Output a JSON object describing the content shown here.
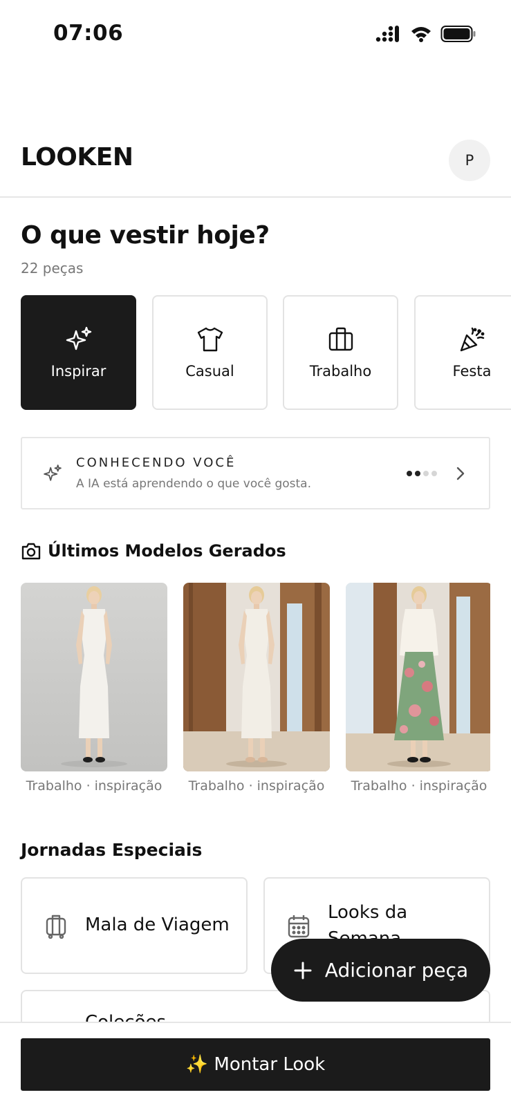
{
  "status_bar": {
    "time": "07:06",
    "icons": [
      "cellular-signal-icon",
      "wifi-icon",
      "battery-icon"
    ]
  },
  "header": {
    "title": "LOOKEN",
    "avatar_initial": "P"
  },
  "greeting": {
    "title": "O que vestir hoje?",
    "pieces": "22 peças"
  },
  "categories": [
    {
      "label": "Inspirar",
      "icon": "sparkles-icon",
      "active": true
    },
    {
      "label": "Casual",
      "icon": "tshirt-icon",
      "active": false
    },
    {
      "label": "Trabalho",
      "icon": "briefcase-icon",
      "active": false
    },
    {
      "label": "Festa",
      "icon": "party-popper-icon",
      "active": false
    }
  ],
  "learning": {
    "title": "CONHECENDO VOCÊ",
    "subtitle": "A IA está aprendendo o que você gosta.",
    "progress_steps_done": 2,
    "progress_steps_total": 4
  },
  "models_section": {
    "title": "Últimos Modelos Gerados",
    "items": [
      {
        "caption": "Trabalho · inspiração"
      },
      {
        "caption": "Trabalho · inspiração"
      },
      {
        "caption": "Trabalho · inspiração"
      }
    ]
  },
  "journeys": {
    "title": "Jornadas Especiais",
    "items": [
      {
        "label": "Mala de Viagem",
        "icon": "luggage-icon"
      },
      {
        "label": "Looks da Semana",
        "icon": "calendar-icon"
      },
      {
        "label": "Coleções",
        "icon": "collection-icon"
      }
    ]
  },
  "fab": {
    "label": "Adicionar peça"
  },
  "cta": {
    "label": "✨ Montar Look"
  },
  "colors": {
    "primary": "#1b1b1b",
    "muted_text": "#777777",
    "border": "#e3e3e3",
    "background": "#ffffff"
  }
}
